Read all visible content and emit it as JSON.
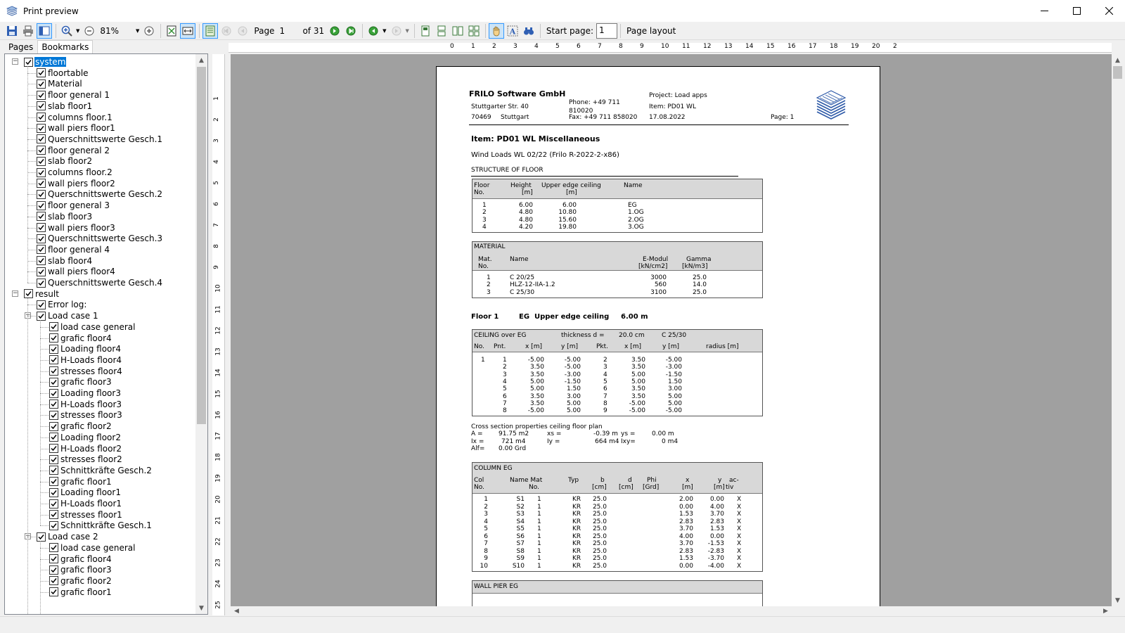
{
  "window": {
    "title": "Print preview"
  },
  "toolbar": {
    "zoom": "81%",
    "page_label": "Page",
    "page_current": "1",
    "page_total": "of 31",
    "start_page_label": "Start page:",
    "start_page_value": "1",
    "page_layout_label": "Page layout"
  },
  "tabs": [
    "Pages",
    "Bookmarks"
  ],
  "tree": {
    "system": "system",
    "system_children": [
      "floortable",
      "Material",
      "floor general 1",
      "slab floor1",
      "columns floor.1",
      "wall piers floor1",
      "Querschnittswerte Gesch.1",
      "floor general 2",
      "slab floor2",
      "columns floor.2",
      "wall piers floor2",
      "Querschnittswerte Gesch.2",
      "floor general 3",
      "slab floor3",
      "wall piers floor3",
      "Querschnittswerte Gesch.3",
      "floor general 4",
      "slab floor4",
      "wall piers floor4",
      "Querschnittswerte Gesch.4"
    ],
    "result": "result",
    "error_log": "Error log:",
    "load_case_1": "Load case 1",
    "load_case_1_children": [
      "load case general",
      "grafic floor4",
      "Loading floor4",
      "H-Loads floor4",
      "stresses floor4",
      "grafic floor3",
      "Loading floor3",
      "H-Loads floor3",
      "stresses floor3",
      "grafic floor2",
      "Loading floor2",
      "H-Loads floor2",
      "stresses floor2",
      "Schnittkräfte Gesch.2",
      "grafic floor1",
      "Loading floor1",
      "H-Loads floor1",
      "stresses floor1",
      "Schnittkräfte Gesch.1"
    ],
    "load_case_2": "Load case 2",
    "load_case_2_children": [
      "load case general",
      "grafic floor4",
      "grafic floor3",
      "grafic floor2",
      "grafic floor1"
    ]
  },
  "ruler": {
    "h": [
      "0",
      "1",
      "2",
      "3",
      "4",
      "5",
      "6",
      "7",
      "8",
      "9",
      "10",
      "11",
      "12",
      "13",
      "14",
      "15",
      "16",
      "17",
      "18",
      "19",
      "20",
      "2"
    ],
    "v": [
      "1",
      "2",
      "3",
      "4",
      "5",
      "6",
      "7",
      "8",
      "9",
      "10",
      "11",
      "12",
      "13",
      "14",
      "15",
      "16",
      "17",
      "18",
      "19",
      "20",
      "21",
      "22",
      "23",
      "24",
      "25"
    ]
  },
  "doc": {
    "company": "FRILO Software GmbH",
    "street": "Stuttgarter Str. 40",
    "zip": "70469",
    "city": "Stuttgart",
    "phone_label": "Phone: +49 711",
    "phone_num": "810020",
    "fax": "Fax: +49 711 858020",
    "project": "Project: Load apps",
    "item_hdr": "Item: PD01 WL",
    "date": "17.08.2022",
    "page": "Page: 1",
    "item_title": "Item: PD01 WL  Miscellaneous",
    "subtitle": "Wind Loads   WL   02/22 (Frilo R-2022-2-x86)",
    "structure_title": "STRUCTURE OF FLOOR",
    "floor_headers": {
      "floor": "Floor",
      "no": "No.",
      "height": "Height",
      "height_unit": "[m]",
      "upper": "Upper edge ceiling",
      "upper_unit": "[m]",
      "name": "Name"
    },
    "floors": [
      {
        "no": "1",
        "height": "6.00",
        "upper": "6.00",
        "name": "EG"
      },
      {
        "no": "2",
        "height": "4.80",
        "upper": "10.80",
        "name": "1.OG"
      },
      {
        "no": "3",
        "height": "4.80",
        "upper": "15.60",
        "name": "2.OG"
      },
      {
        "no": "4",
        "height": "4.20",
        "upper": "19.80",
        "name": "3.OG"
      }
    ],
    "material_title": "MATERIAL",
    "mat_headers": {
      "mat": "Mat.",
      "no": "No.",
      "name": "Name",
      "emod": "E-Modul",
      "emod_unit": "[kN/cm2]",
      "gamma": "Gamma",
      "gamma_unit": "[kN/m3]"
    },
    "materials": [
      {
        "no": "1",
        "name": "C 20/25",
        "emod": "3000",
        "gamma": "25.0"
      },
      {
        "no": "2",
        "name": "HLZ-12-IIA-1.2",
        "emod": "560",
        "gamma": "14.0"
      },
      {
        "no": "3",
        "name": "C 25/30",
        "emod": "3100",
        "gamma": "25.0"
      }
    ],
    "floor1": {
      "label": "Floor 1",
      "name": "EG",
      "upper_label": "Upper edge ceiling",
      "upper_value": "6.00 m"
    },
    "ceiling": {
      "title": "CEILING over EG",
      "thickness_label": "thickness d =",
      "thickness_value": "20.0 cm",
      "material": "C 25/30",
      "headers": {
        "no": "No.",
        "pnt": "Pnt.",
        "x": "x [m]",
        "y": "y [m]",
        "pkt": "Pkt.",
        "x2": "x [m]",
        "y2": "y [m]",
        "radius": "radius [m]"
      },
      "no": "1",
      "rows": [
        {
          "pnt": "1",
          "x": "-5.00",
          "y": "-5.00",
          "pkt": "2",
          "x2": "3.50",
          "y2": "-5.00"
        },
        {
          "pnt": "2",
          "x": "3.50",
          "y": "-5.00",
          "pkt": "3",
          "x2": "3.50",
          "y2": "-3.00"
        },
        {
          "pnt": "3",
          "x": "3.50",
          "y": "-3.00",
          "pkt": "4",
          "x2": "5.00",
          "y2": "-1.50"
        },
        {
          "pnt": "4",
          "x": "5.00",
          "y": "-1.50",
          "pkt": "5",
          "x2": "5.00",
          "y2": "1.50"
        },
        {
          "pnt": "5",
          "x": "5.00",
          "y": "1.50",
          "pkt": "6",
          "x2": "3.50",
          "y2": "3.00"
        },
        {
          "pnt": "6",
          "x": "3.50",
          "y": "3.00",
          "pkt": "7",
          "x2": "3.50",
          "y2": "5.00"
        },
        {
          "pnt": "7",
          "x": "3.50",
          "y": "5.00",
          "pkt": "8",
          "x2": "-5.00",
          "y2": "5.00"
        },
        {
          "pnt": "8",
          "x": "-5.00",
          "y": "5.00",
          "pkt": "9",
          "x2": "-5.00",
          "y2": "-5.00"
        }
      ]
    },
    "cross": {
      "title": "Cross section properties ceiling floor plan",
      "l1": [
        "A    =",
        "91.75 m2",
        "xs =",
        "-0.39 m",
        "ys =",
        "0.00 m"
      ],
      "l2": [
        "Ix =",
        "721 m4",
        "Iy =",
        "664 m4",
        "Ixy=",
        "0 m4"
      ],
      "l3": [
        "Alf=",
        "0.00 Grd"
      ]
    },
    "column": {
      "title": "COLUMN  EG",
      "headers": {
        "col": "Col",
        "no": "No.",
        "name": "Name Mat",
        "matno": "No.",
        "typ": "Typ",
        "b": "b",
        "b_u": "[cm]",
        "d": "d",
        "d_u": "[cm]",
        "phi": "Phi",
        "phi_u": "[Grd]",
        "x": "x",
        "x_u": "[m]",
        "y": "y",
        "y_u": "[m]",
        "ac": "ac-",
        "ac2": "tiv"
      },
      "rows": [
        {
          "no": "1",
          "name": "S1",
          "mat": "1",
          "typ": "KR",
          "b": "25.0",
          "x": "2.00",
          "y": "0.00",
          "ac": "X"
        },
        {
          "no": "2",
          "name": "S2",
          "mat": "1",
          "typ": "KR",
          "b": "25.0",
          "x": "0.00",
          "y": "4.00",
          "ac": "X"
        },
        {
          "no": "3",
          "name": "S3",
          "mat": "1",
          "typ": "KR",
          "b": "25.0",
          "x": "1.53",
          "y": "3.70",
          "ac": "X"
        },
        {
          "no": "4",
          "name": "S4",
          "mat": "1",
          "typ": "KR",
          "b": "25.0",
          "x": "2.83",
          "y": "2.83",
          "ac": "X"
        },
        {
          "no": "5",
          "name": "S5",
          "mat": "1",
          "typ": "KR",
          "b": "25.0",
          "x": "3.70",
          "y": "1.53",
          "ac": "X"
        },
        {
          "no": "6",
          "name": "S6",
          "mat": "1",
          "typ": "KR",
          "b": "25.0",
          "x": "4.00",
          "y": "0.00",
          "ac": "X"
        },
        {
          "no": "7",
          "name": "S7",
          "mat": "1",
          "typ": "KR",
          "b": "25.0",
          "x": "3.70",
          "y": "-1.53",
          "ac": "X"
        },
        {
          "no": "8",
          "name": "S8",
          "mat": "1",
          "typ": "KR",
          "b": "25.0",
          "x": "2.83",
          "y": "-2.83",
          "ac": "X"
        },
        {
          "no": "9",
          "name": "S9",
          "mat": "1",
          "typ": "KR",
          "b": "25.0",
          "x": "1.53",
          "y": "-3.70",
          "ac": "X"
        },
        {
          "no": "10",
          "name": "S10",
          "mat": "1",
          "typ": "KR",
          "b": "25.0",
          "x": "0.00",
          "y": "-4.00",
          "ac": "X"
        }
      ]
    },
    "wallpier_title": "WALL PIER      EG"
  },
  "colors": {
    "selection": "#0078d7",
    "canvas": "#a0a0a0",
    "header_shade": "#d8d8d8",
    "logo_blue": "#2e5aa8"
  }
}
